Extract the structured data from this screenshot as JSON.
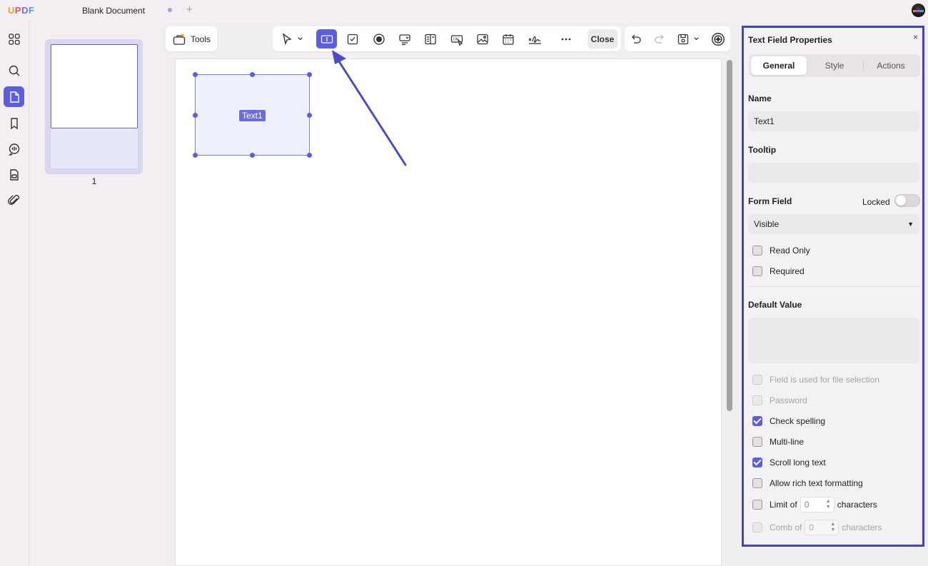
{
  "app": {
    "logo": {
      "u": "U",
      "p": "P",
      "d": "D",
      "f": "F"
    },
    "tab_title": "Blank Document",
    "new_tab": "+"
  },
  "left_rail": {
    "items": [
      {
        "name": "thumbnails-icon"
      },
      {
        "name": "search-icon"
      },
      {
        "name": "page-edit-icon",
        "active": true
      },
      {
        "name": "bookmark-icon"
      },
      {
        "name": "comment-icon"
      },
      {
        "name": "stamp-icon"
      },
      {
        "name": "attachment-icon"
      }
    ]
  },
  "thumbnails": {
    "page_number": "1"
  },
  "toolbar": {
    "tools_label": "Tools",
    "close_label": "Close"
  },
  "page": {
    "field_label": "Text1"
  },
  "props": {
    "title": "Text Field Properties",
    "close": "×",
    "tabs": [
      "General",
      "Style",
      "Actions"
    ],
    "active_tab": "General",
    "name_label": "Name",
    "name_value": "Text1",
    "tooltip_label": "Tooltip",
    "tooltip_value": "",
    "form_field_label": "Form Field",
    "locked_label": "Locked",
    "locked": false,
    "visibility": "Visible",
    "read_only": {
      "label": "Read Only",
      "checked": false
    },
    "required": {
      "label": "Required",
      "checked": false
    },
    "default_value_label": "Default Value",
    "default_value": "",
    "options": [
      {
        "label": "Field is used for file selection",
        "checked": false,
        "disabled": true
      },
      {
        "label": "Password",
        "checked": false,
        "disabled": true
      },
      {
        "label": "Check spelling",
        "checked": true,
        "disabled": false
      },
      {
        "label": "Multi-line",
        "checked": false,
        "disabled": false
      },
      {
        "label": "Scroll long text",
        "checked": true,
        "disabled": false
      },
      {
        "label": "Allow rich text formatting",
        "checked": false,
        "disabled": false
      }
    ],
    "limit": {
      "prefix": "Limit of",
      "value": "0",
      "suffix": "characters",
      "checked": false,
      "disabled": false
    },
    "comb": {
      "prefix": "Comb of",
      "value": "0",
      "suffix": "characters",
      "checked": false,
      "disabled": true
    }
  },
  "colors": {
    "accent": "#5b5ee0",
    "highlight_border": "#4045b8"
  }
}
